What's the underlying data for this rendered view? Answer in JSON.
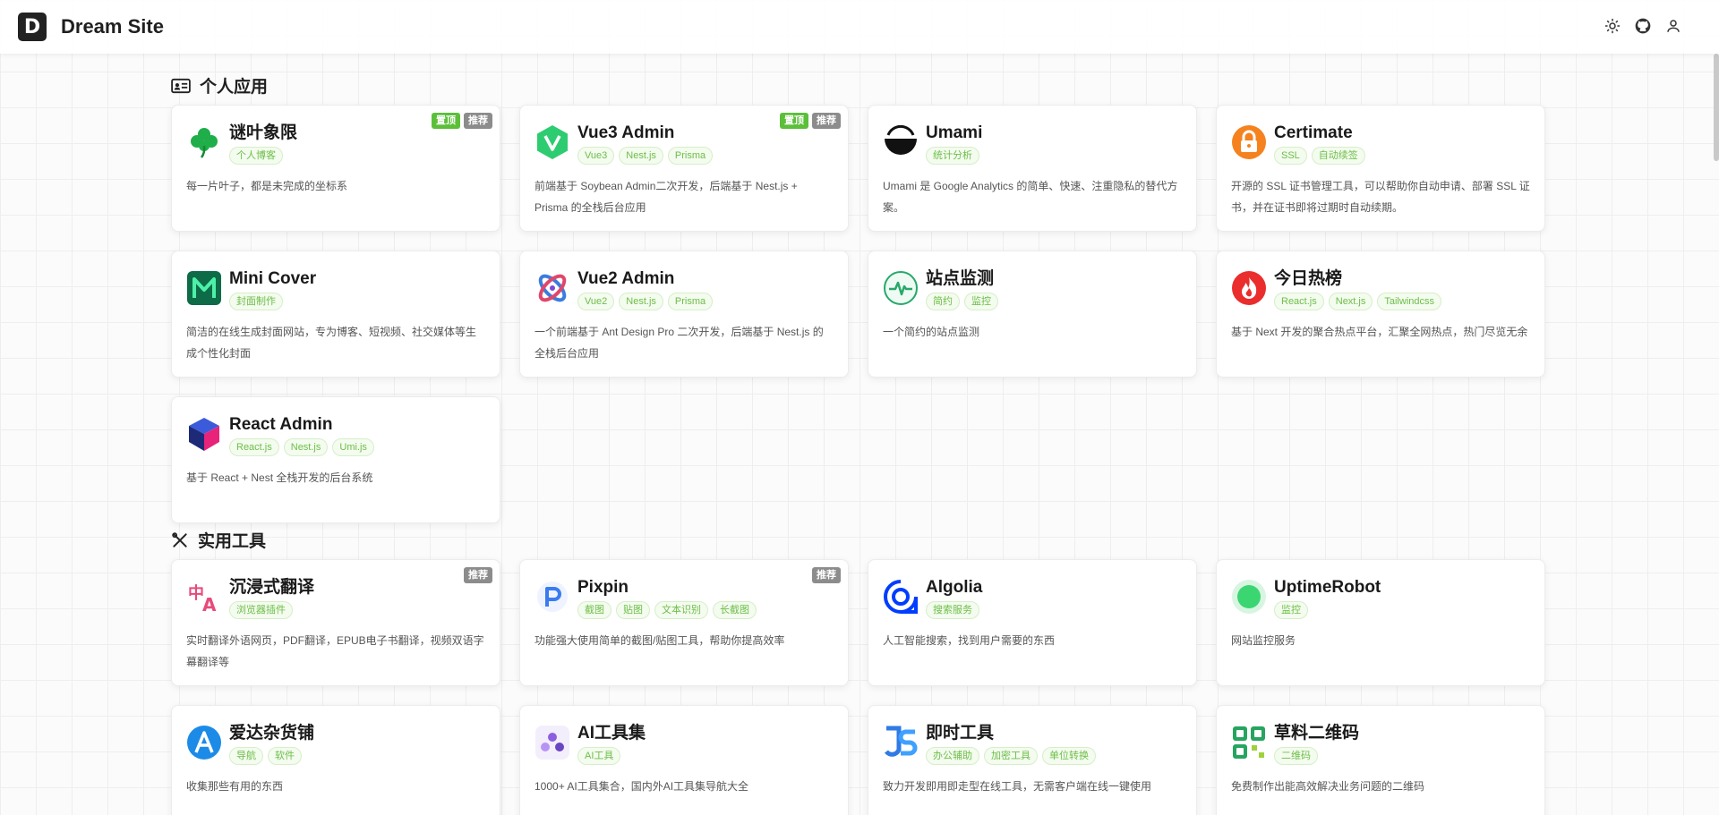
{
  "header": {
    "logo_letter": "D",
    "title": "Dream Site"
  },
  "sections": [
    {
      "title": "个人应用",
      "cards": [
        {
          "name": "谜叶象限",
          "tags": [
            "个人博客"
          ],
          "desc": "每一片叶子，都是未完成的坐标系",
          "badges": [
            {
              "text": "置顶",
              "color": "green"
            },
            {
              "text": "推荐",
              "color": "gray"
            }
          ],
          "icon": "clover-icon"
        },
        {
          "name": "Vue3 Admin",
          "tags": [
            "Vue3",
            "Nest.js",
            "Prisma"
          ],
          "desc": "前端基于 Soybean Admin二次开发，后端基于 Nest.js + Prisma 的全栈后台应用",
          "badges": [
            {
              "text": "置顶",
              "color": "green"
            },
            {
              "text": "推荐",
              "color": "gray"
            }
          ],
          "icon": "vue-hexagon-icon"
        },
        {
          "name": "Umami",
          "tags": [
            "统计分析"
          ],
          "desc": "Umami 是 Google Analytics 的简单、快速、注重隐私的替代方案。",
          "badges": [],
          "icon": "umami-bowl-icon"
        },
        {
          "name": "Certimate",
          "tags": [
            "SSL",
            "自动续签"
          ],
          "desc": "开源的 SSL 证书管理工具，可以帮助你自动申请、部署 SSL 证书，并在证书即将过期时自动续期。",
          "badges": [],
          "icon": "lock-icon"
        },
        {
          "name": "Mini Cover",
          "tags": [
            "封面制作"
          ],
          "desc": "简洁的在线生成封面网站，专为博客、短视频、社交媒体等生成个性化封面",
          "badges": [],
          "icon": "m-logo-icon"
        },
        {
          "name": "Vue2 Admin",
          "tags": [
            "Vue2",
            "Nest.js",
            "Prisma"
          ],
          "desc": "一个前端基于 Ant Design Pro 二次开发，后端基于 Nest.js 的全栈后台应用",
          "badges": [],
          "icon": "knot-icon"
        },
        {
          "name": "站点监测",
          "tags": [
            "简约",
            "监控"
          ],
          "desc": "一个简约的站点监测",
          "badges": [],
          "icon": "heartbeat-icon"
        },
        {
          "name": "今日热榜",
          "tags": [
            "React.js",
            "Next.js",
            "Tailwindcss"
          ],
          "desc": "基于 Next 开发的聚合热点平台，汇聚全网热点，热门尽览无余",
          "badges": [],
          "icon": "flame-icon"
        },
        {
          "name": "React Admin",
          "tags": [
            "React.js",
            "Nest.js",
            "Umi.js"
          ],
          "desc": "基于 React + Nest 全栈开发的后台系统",
          "badges": [],
          "icon": "cube-icon"
        }
      ]
    },
    {
      "title": "实用工具",
      "cards": [
        {
          "name": "沉浸式翻译",
          "tags": [
            "浏览器插件"
          ],
          "desc": "实时翻译外语网页，PDF翻译，EPUB电子书翻译，视频双语字幕翻译等",
          "badges": [
            {
              "text": "推荐",
              "color": "gray"
            }
          ],
          "icon": "translate-icon"
        },
        {
          "name": "Pixpin",
          "tags": [
            "截图",
            "贴图",
            "文本识别",
            "长截图"
          ],
          "desc": "功能强大使用简单的截图/贴图工具，帮助你提高效率",
          "badges": [
            {
              "text": "推荐",
              "color": "gray"
            }
          ],
          "icon": "pixpin-icon"
        },
        {
          "name": "Algolia",
          "tags": [
            "搜索服务"
          ],
          "desc": "人工智能搜索，找到用户需要的东西",
          "badges": [],
          "icon": "algolia-icon"
        },
        {
          "name": "UptimeRobot",
          "tags": [
            "监控"
          ],
          "desc": "网站监控服务",
          "badges": [],
          "icon": "green-dot-icon"
        },
        {
          "name": "爱达杂货铺",
          "tags": [
            "导航",
            "软件"
          ],
          "desc": "收集那些有用的东西",
          "badges": [],
          "icon": "letter-a-icon"
        },
        {
          "name": "AI工具集",
          "tags": [
            "AI工具"
          ],
          "desc": "1000+ AI工具集合，国内外AI工具集导航大全",
          "badges": [],
          "icon": "ai-tools-icon"
        },
        {
          "name": "即时工具",
          "tags": [
            "办公辅助",
            "加密工具",
            "单位转换"
          ],
          "desc": "致力开发即用即走型在线工具，无需客户端在线一键使用",
          "badges": [],
          "icon": "js-icon"
        },
        {
          "name": "草料二维码",
          "tags": [
            "二维码"
          ],
          "desc": "免费制作出能高效解决业务问题的二维码",
          "badges": [],
          "icon": "qr-icon"
        }
      ]
    }
  ]
}
